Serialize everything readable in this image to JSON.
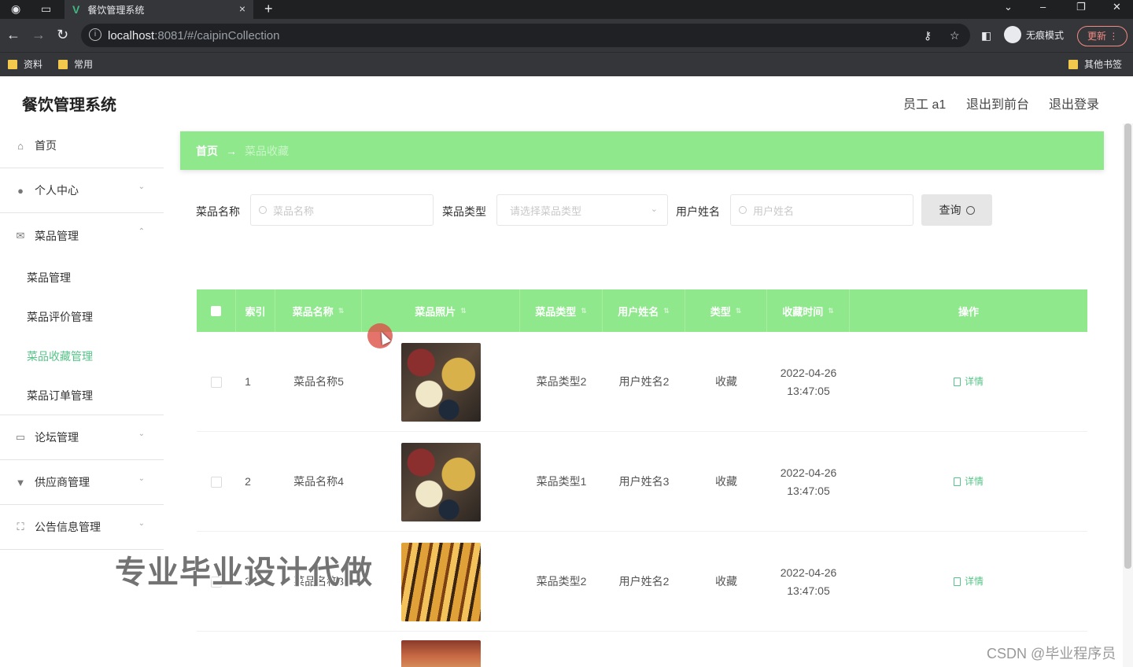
{
  "browser": {
    "tab_title": "餐饮管理系统",
    "url_host": "localhost",
    "url_rest": ":8081/#/caipinCollection",
    "incognito_label": "无痕模式",
    "update_label": "更新",
    "bookmarks": [
      "资料",
      "常用"
    ],
    "other_bookmarks": "其他书签"
  },
  "header": {
    "app_title": "餐饮管理系统",
    "user": "员工 a1",
    "to_front": "退出到前台",
    "logout": "退出登录"
  },
  "sidebar": {
    "home": "首页",
    "personal": "个人中心",
    "dish_mgmt": "菜品管理",
    "sub": [
      "菜品管理",
      "菜品评价管理",
      "菜品收藏管理",
      "菜品订单管理"
    ],
    "forum": "论坛管理",
    "supplier": "供应商管理",
    "notice": "公告信息管理",
    "active_sub_index": 2
  },
  "breadcrumb": {
    "home": "首页",
    "arrow": "→",
    "current": "菜品收藏"
  },
  "filters": {
    "name_label": "菜品名称",
    "name_placeholder": "菜品名称",
    "type_label": "菜品类型",
    "type_placeholder": "请选择菜品类型",
    "user_label": "用户姓名",
    "user_placeholder": "用户姓名",
    "query": "查询"
  },
  "table": {
    "columns": [
      "索引",
      "菜品名称",
      "菜品照片",
      "菜品类型",
      "用户姓名",
      "类型",
      "收藏时间",
      "操作"
    ],
    "rows": [
      {
        "index": "1",
        "name": "菜品名称5",
        "type": "菜品类型2",
        "user": "用户姓名2",
        "kind": "收藏",
        "date": "2022-04-26",
        "time": "13:47:05",
        "action": "详情"
      },
      {
        "index": "2",
        "name": "菜品名称4",
        "type": "菜品类型1",
        "user": "用户姓名3",
        "kind": "收藏",
        "date": "2022-04-26",
        "time": "13:47:05",
        "action": "详情"
      },
      {
        "index": "3",
        "name": "菜品名称3",
        "type": "菜品类型2",
        "user": "用户姓名2",
        "kind": "收藏",
        "date": "2022-04-26",
        "time": "13:47:05",
        "action": "详情"
      }
    ]
  },
  "overlay": {
    "watermark": "专业毕业设计代做",
    "csdn": "CSDN @毕业程序员"
  },
  "colors": {
    "accent_green": "#8fe88c",
    "active_text": "#56c488"
  }
}
